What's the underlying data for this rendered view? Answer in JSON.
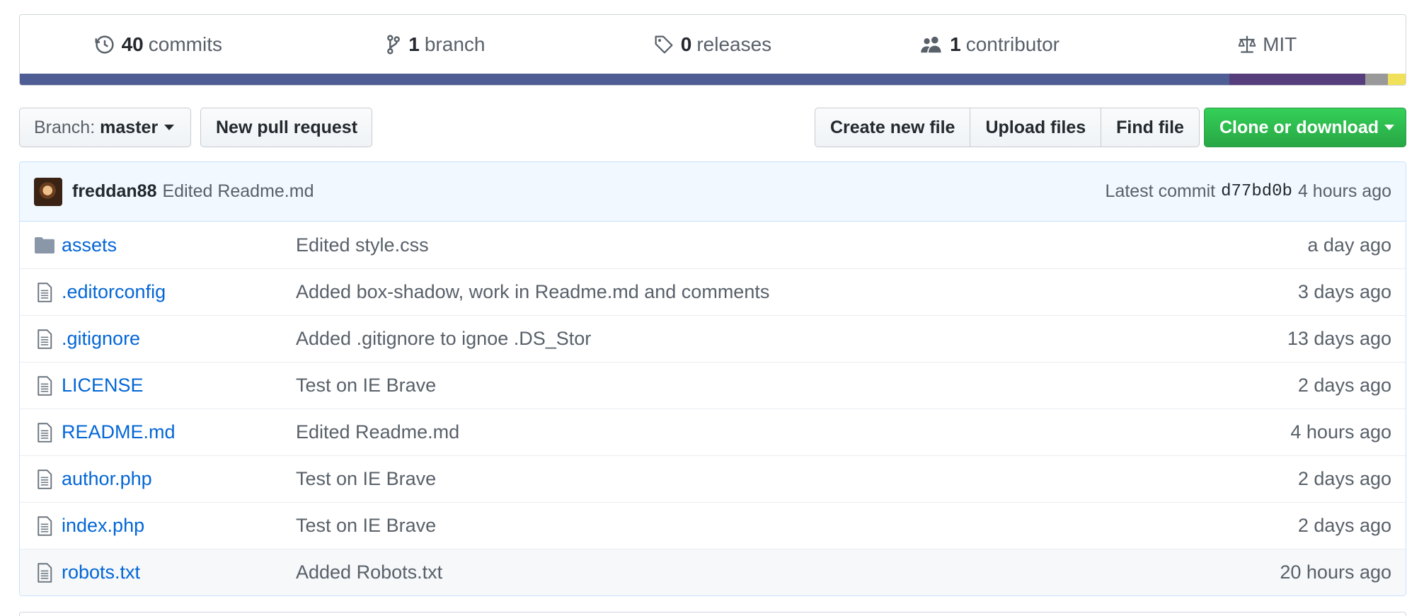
{
  "summary": {
    "commits": {
      "num": "40",
      "label": "commits",
      "icon": "history-icon"
    },
    "branches": {
      "num": "1",
      "label": "branch",
      "icon": "git-branch-icon"
    },
    "releases": {
      "num": "0",
      "label": "releases",
      "icon": "tag-icon"
    },
    "contributors": {
      "num": "1",
      "label": "contributor",
      "icon": "people-icon"
    },
    "license": {
      "label": "MIT",
      "icon": "law-icon"
    }
  },
  "language_bar": [
    {
      "color": "#4F5D95",
      "share": 0.873
    },
    {
      "color": "#563d7c",
      "share": 0.098
    },
    {
      "color": "#999999",
      "share": 0.016
    },
    {
      "color": "#f1e05a",
      "share": 0.013
    }
  ],
  "toolbar": {
    "branch_prefix": "Branch:",
    "branch_name": "master",
    "new_pr": "New pull request",
    "create_file": "Create new file",
    "upload_files": "Upload files",
    "find_file": "Find file",
    "clone": "Clone or download"
  },
  "latest_commit": {
    "author": "freddan88",
    "message": "Edited Readme.md",
    "prefix": "Latest commit",
    "sha": "d77bd0b",
    "age": "4 hours ago"
  },
  "files": [
    {
      "name": "assets",
      "type": "directory",
      "icon": "folder-icon",
      "message": "Edited style.css",
      "age": "a day ago"
    },
    {
      "name": ".editorconfig",
      "type": "file",
      "icon": "file-icon",
      "message": "Added box-shadow, work in Readme.md and comments",
      "age": "3 days ago"
    },
    {
      "name": ".gitignore",
      "type": "file",
      "icon": "file-icon",
      "message": "Added .gitignore to ignoe .DS_Stor",
      "age": "13 days ago"
    },
    {
      "name": "LICENSE",
      "type": "file",
      "icon": "file-icon",
      "message": "Test on IE Brave",
      "age": "2 days ago"
    },
    {
      "name": "README.md",
      "type": "file",
      "icon": "file-icon",
      "message": "Edited Readme.md",
      "age": "4 hours ago"
    },
    {
      "name": "author.php",
      "type": "file",
      "icon": "file-icon",
      "message": "Test on IE Brave",
      "age": "2 days ago"
    },
    {
      "name": "index.php",
      "type": "file",
      "icon": "file-icon",
      "message": "Test on IE Brave",
      "age": "2 days ago"
    },
    {
      "name": "robots.txt",
      "type": "file",
      "icon": "file-icon",
      "message": "Added Robots.txt",
      "age": "20 hours ago"
    }
  ]
}
